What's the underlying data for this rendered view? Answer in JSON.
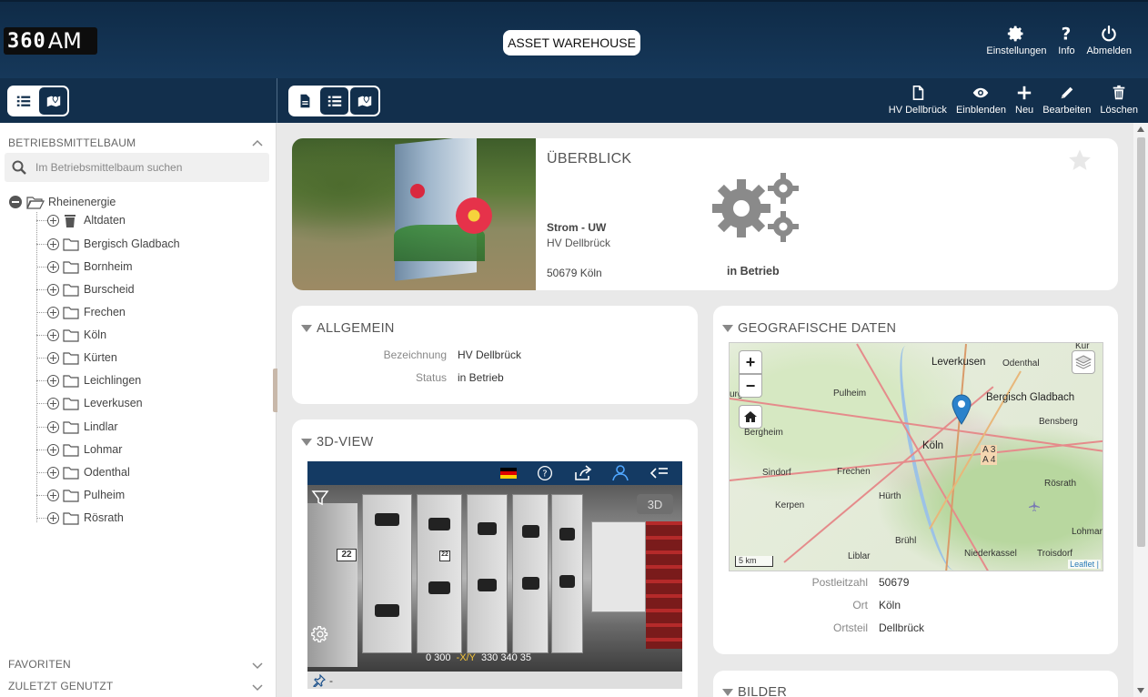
{
  "header": {
    "logo_num": "360",
    "logo_rest": "AM",
    "center_button": "ASSET WAREHOUSE",
    "actions": [
      {
        "label": "Einstellungen",
        "icon": "gear-icon"
      },
      {
        "label": "Info",
        "icon": "question-icon"
      },
      {
        "label": "Abmelden",
        "icon": "power-icon"
      }
    ]
  },
  "subbar": {
    "actions": [
      {
        "label": "HV Dellbrück",
        "icon": "document-icon"
      },
      {
        "label": "Einblenden",
        "icon": "eye-icon"
      },
      {
        "label": "Neu",
        "icon": "plus-icon"
      },
      {
        "label": "Bearbeiten",
        "icon": "pencil-icon"
      },
      {
        "label": "Löschen",
        "icon": "trash-icon"
      }
    ]
  },
  "sidebar": {
    "tree_title": "BETRIEBSMITTELBAUM",
    "search_placeholder": "Im Betriebsmittelbaum suchen",
    "root": "Rheinenergie",
    "items": [
      {
        "label": "Altdaten",
        "icon": "trash-icon"
      },
      {
        "label": "Bergisch Gladbach",
        "icon": "folder-icon"
      },
      {
        "label": "Bornheim",
        "icon": "folder-icon"
      },
      {
        "label": "Burscheid",
        "icon": "folder-icon"
      },
      {
        "label": "Frechen",
        "icon": "folder-icon"
      },
      {
        "label": "Köln",
        "icon": "folder-icon"
      },
      {
        "label": "Kürten",
        "icon": "folder-icon"
      },
      {
        "label": "Leichlingen",
        "icon": "folder-icon"
      },
      {
        "label": "Leverkusen",
        "icon": "folder-icon"
      },
      {
        "label": "Lindlar",
        "icon": "folder-icon"
      },
      {
        "label": "Lohmar",
        "icon": "folder-icon"
      },
      {
        "label": "Odenthal",
        "icon": "folder-icon"
      },
      {
        "label": "Pulheim",
        "icon": "folder-icon"
      },
      {
        "label": "Rösrath",
        "icon": "folder-icon"
      }
    ],
    "favorites": "FAVORITEN",
    "recent": "ZULETZT GENUTZT"
  },
  "overview": {
    "title": "ÜBERBLICK",
    "type": "Strom - UW",
    "name": "HV Dellbrück",
    "address": "50679 Köln",
    "status": "in Betrieb"
  },
  "allgemein": {
    "title": "ALLGEMEIN",
    "rows": [
      {
        "key": "Bezeichnung",
        "value": "HV Dellbrück"
      },
      {
        "key": "Status",
        "value": "in Betrieb"
      }
    ]
  },
  "view3d": {
    "title": "3D-VIEW",
    "badge": "3D",
    "compass_left": "0  300",
    "compass_cur": "-X/Y",
    "compass_right": "330  340  35",
    "bottom_text": "-",
    "cabinet_labels": [
      "22",
      "22"
    ]
  },
  "geo": {
    "title": "GEOGRAFISCHE DATEN",
    "map_labels": {
      "leverkusen": "Leverkusen",
      "odenthal": "Odenthal",
      "bergisch": "Bergisch Gladbach",
      "pulheim": "Pulheim",
      "bensberg": "Bensberg",
      "bergheim": "Bergheim",
      "koeln": "Köln",
      "a3": "A 3",
      "a4": "A 4",
      "sindorf": "Sindorf",
      "frechen": "Frechen",
      "roesrath": "Rösrath",
      "kerpen": "Kerpen",
      "huerth": "Hürth",
      "lohmar": "Lohmar",
      "bruehl": "Brühl",
      "niederkassel": "Niederkassel",
      "troisdorf": "Troisdorf",
      "liblar": "Liblar",
      "kuer": "Kür",
      "urg": "urg"
    },
    "scale": "5 km",
    "attribution": "Leaflet |",
    "zoom_in": "+",
    "zoom_out": "−",
    "rows": [
      {
        "key": "Postleitzahl",
        "value": "50679"
      },
      {
        "key": "Ort",
        "value": "Köln"
      },
      {
        "key": "Ortsteil",
        "value": "Dellbrück"
      }
    ]
  },
  "bilder": {
    "title": "BILDER"
  }
}
